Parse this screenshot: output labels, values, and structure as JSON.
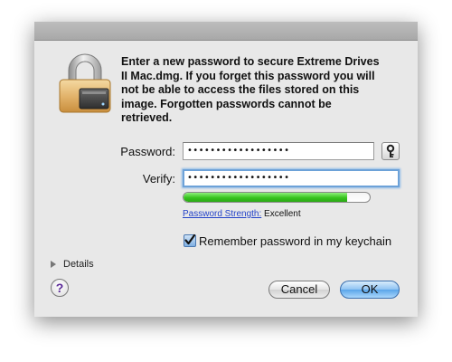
{
  "dialog": {
    "message": "Enter a new password to secure Extreme Drives\nII Mac.dmg.  If you forget this password you will\nnot be able to access the files stored on this\nimage. Forgotten passwords cannot be\nretrieved."
  },
  "form": {
    "password_label": "Password:",
    "password_value": "••••••••••••••••••",
    "verify_label": "Verify:",
    "verify_value": "••••••••••••••••••",
    "key_icon": "key-icon"
  },
  "strength": {
    "link_label": "Password Strength:",
    "value_label": "Excellent",
    "level_fraction": 0.88,
    "color": "#37c41f"
  },
  "keychain": {
    "checked": true,
    "label": "Remember password in my keychain"
  },
  "details": {
    "label": "Details"
  },
  "buttons": {
    "help_label": "?",
    "cancel_label": "Cancel",
    "ok_label": "OK",
    "default_color": "#5aa5ea"
  }
}
